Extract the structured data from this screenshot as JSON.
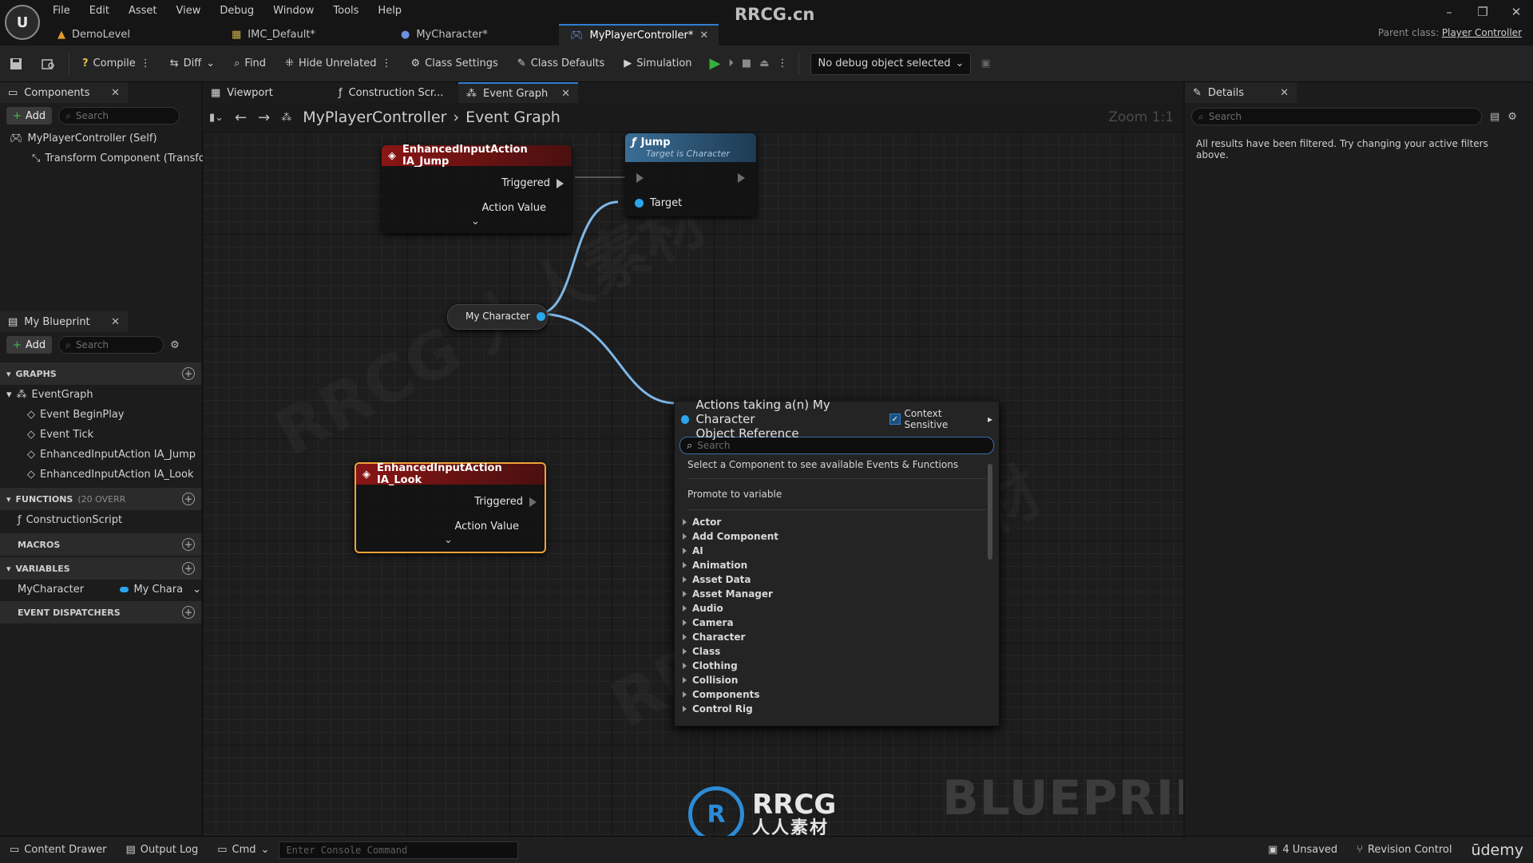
{
  "window": {
    "site_title": "RRCG.cn",
    "logo_text": "U",
    "menu": [
      "File",
      "Edit",
      "Asset",
      "View",
      "Debug",
      "Window",
      "Tools",
      "Help"
    ],
    "doc_tabs": [
      {
        "label": "DemoLevel",
        "active": false
      },
      {
        "label": "IMC_Default*",
        "active": false
      },
      {
        "label": "MyCharacter*",
        "active": false
      },
      {
        "label": "MyPlayerController*",
        "active": true
      }
    ],
    "parent_class_label": "Parent class:",
    "parent_class_value": "Player Controller"
  },
  "toolbar": {
    "compile": "Compile",
    "diff": "Diff",
    "find": "Find",
    "hide_unrelated": "Hide Unrelated",
    "class_settings": "Class Settings",
    "class_defaults": "Class Defaults",
    "simulation": "Simulation",
    "debug_object": "No debug object selected"
  },
  "components_panel": {
    "tab": "Components",
    "add": "Add",
    "search_placeholder": "Search",
    "root": "MyPlayerController (Self)",
    "child": "Transform Component (Transfo"
  },
  "my_blueprint": {
    "tab": "My Blueprint",
    "add": "Add",
    "search_placeholder": "Search",
    "graphs_header": "GRAPHS",
    "event_graph": "EventGraph",
    "graph_items": [
      "Event BeginPlay",
      "Event Tick",
      "EnhancedInputAction IA_Jump",
      "EnhancedInputAction IA_Look"
    ],
    "functions_header": "FUNCTIONS",
    "functions_count": "(20 OVERR",
    "construction_script": "ConstructionScript",
    "macros_header": "MACROS",
    "variables_header": "VARIABLES",
    "variable_name": "MyCharacter",
    "variable_type": "My Chara",
    "dispatchers_header": "EVENT DISPATCHERS"
  },
  "graph_tabs": [
    {
      "label": "Viewport",
      "active": false
    },
    {
      "label": "Construction Scr...",
      "active": false
    },
    {
      "label": "Event Graph",
      "active": true
    }
  ],
  "breadcrumb": {
    "root": "MyPlayerController",
    "leaf": "Event Graph",
    "zoom": "Zoom 1:1"
  },
  "nodes": {
    "ia_jump": {
      "title": "EnhancedInputAction IA_Jump",
      "pin1": "Triggered",
      "pin2": "Action Value"
    },
    "jump": {
      "title": "Jump",
      "subtitle": "Target is Character",
      "pin": "Target"
    },
    "my_character": {
      "label": "My Character"
    },
    "ia_look": {
      "title": "EnhancedInputAction IA_Look",
      "pin1": "Triggered",
      "pin2": "Action Value"
    }
  },
  "context_menu": {
    "title_line1": "Actions taking a(n) My Character",
    "title_line2": "Object Reference",
    "context_sensitive": "Context Sensitive",
    "search_placeholder": "Search",
    "hint": "Select a Component to see available Events & Functions",
    "promote": "Promote to variable",
    "categories": [
      "Actor",
      "Add Component",
      "AI",
      "Animation",
      "Asset Data",
      "Asset Manager",
      "Audio",
      "Camera",
      "Character",
      "Class",
      "Clothing",
      "Collision",
      "Components",
      "Control Rig"
    ]
  },
  "graph_watermark": "BLUEPRINT",
  "overlay_logo": {
    "text_top": "RRCG",
    "text_bottom": "人人素材"
  },
  "details_panel": {
    "tab": "Details",
    "search_placeholder": "Search",
    "message": "All results have been filtered. Try changing your active filters above."
  },
  "statusbar": {
    "content_drawer": "Content Drawer",
    "output_log": "Output Log",
    "cmd": "Cmd",
    "console_placeholder": "Enter Console Command",
    "unsaved": "4 Unsaved",
    "revision": "Revision Control",
    "udemy": "ūdemy"
  },
  "colors": {
    "accent_blue": "#2f7fd1",
    "event_node_header": "#7a1414",
    "function_node_header": "#3a6e96",
    "object_pin": "#2aa6ef",
    "selected_node_border": "#f0a23a"
  }
}
